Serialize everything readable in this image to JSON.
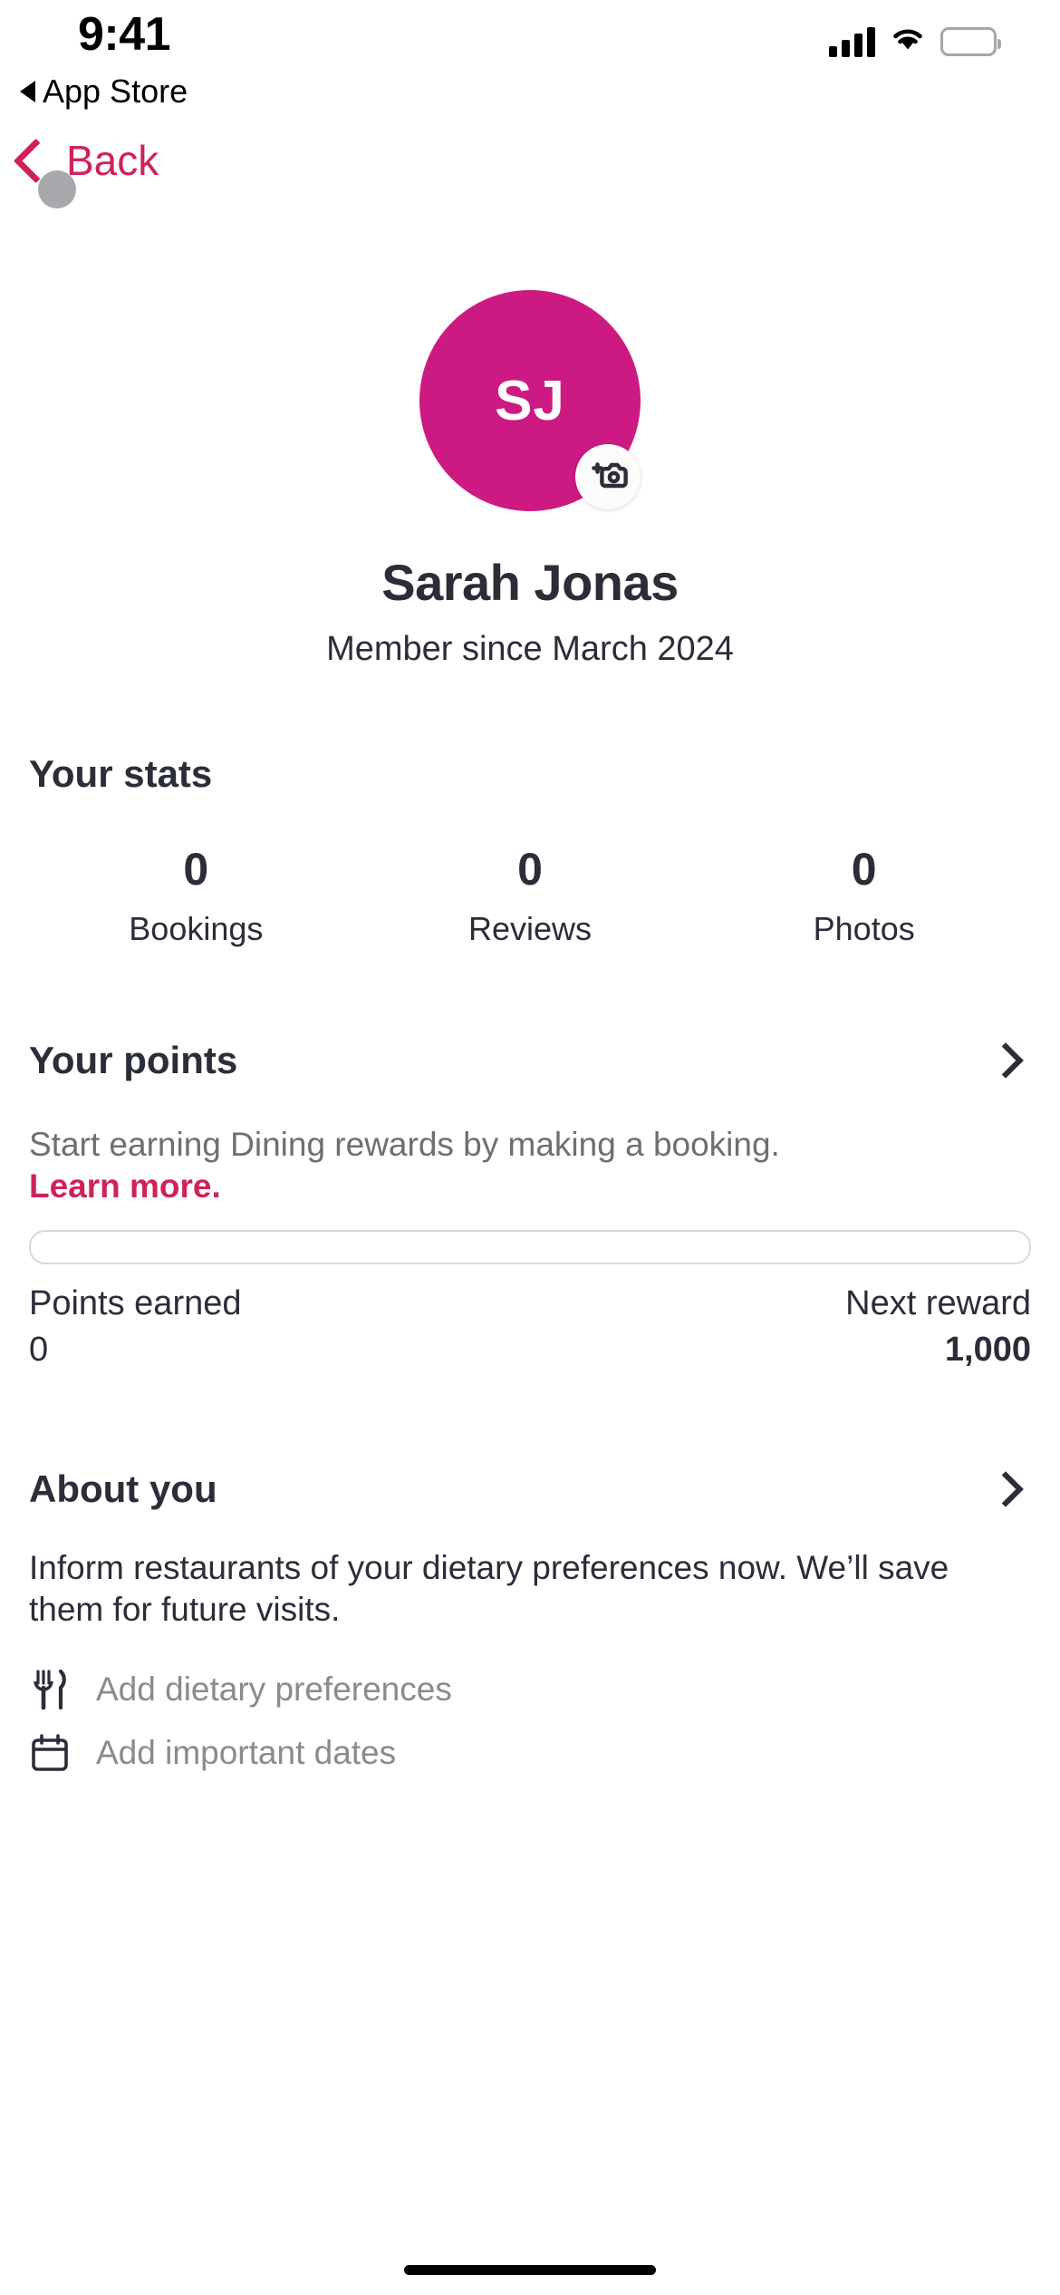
{
  "status_bar": {
    "time": "9:41",
    "return_app": "App Store",
    "signal_icon": "cellular-bars-icon",
    "wifi_icon": "wifi-icon",
    "battery_icon": "battery-icon"
  },
  "nav": {
    "back_label": "Back",
    "back_icon": "chevron-left-icon",
    "touch_indicator": "touch-dot"
  },
  "profile": {
    "initials": "SJ",
    "avatar_color": "#CC1A82",
    "camera_icon": "add-photo-camera-icon",
    "name": "Sarah Jonas",
    "member_since": "Member since March 2024"
  },
  "stats": {
    "title": "Your stats",
    "items": [
      {
        "value": "0",
        "label": "Bookings"
      },
      {
        "value": "0",
        "label": "Reviews"
      },
      {
        "value": "0",
        "label": "Photos"
      }
    ]
  },
  "points": {
    "title": "Your points",
    "chevron_icon": "chevron-right-icon",
    "description": "Start earning Dining rewards by making a booking.",
    "learn_more": "Learn more.",
    "progress_percent": 0,
    "earned_label": "Points earned",
    "earned_value": "0",
    "next_reward_label": "Next reward",
    "next_reward_value": "1,000"
  },
  "about": {
    "title": "About you",
    "chevron_icon": "chevron-right-icon",
    "description": "Inform restaurants of your dietary preferences now. We’ll save them for future visits.",
    "items": [
      {
        "icon": "fork-knife-icon",
        "label": "Add dietary preferences"
      },
      {
        "icon": "calendar-icon",
        "label": "Add important dates"
      }
    ]
  },
  "theme": {
    "accent": "#CF2358",
    "avatar": "#CC1A82",
    "text": "#2B2D38",
    "muted": "#6E6E73"
  }
}
